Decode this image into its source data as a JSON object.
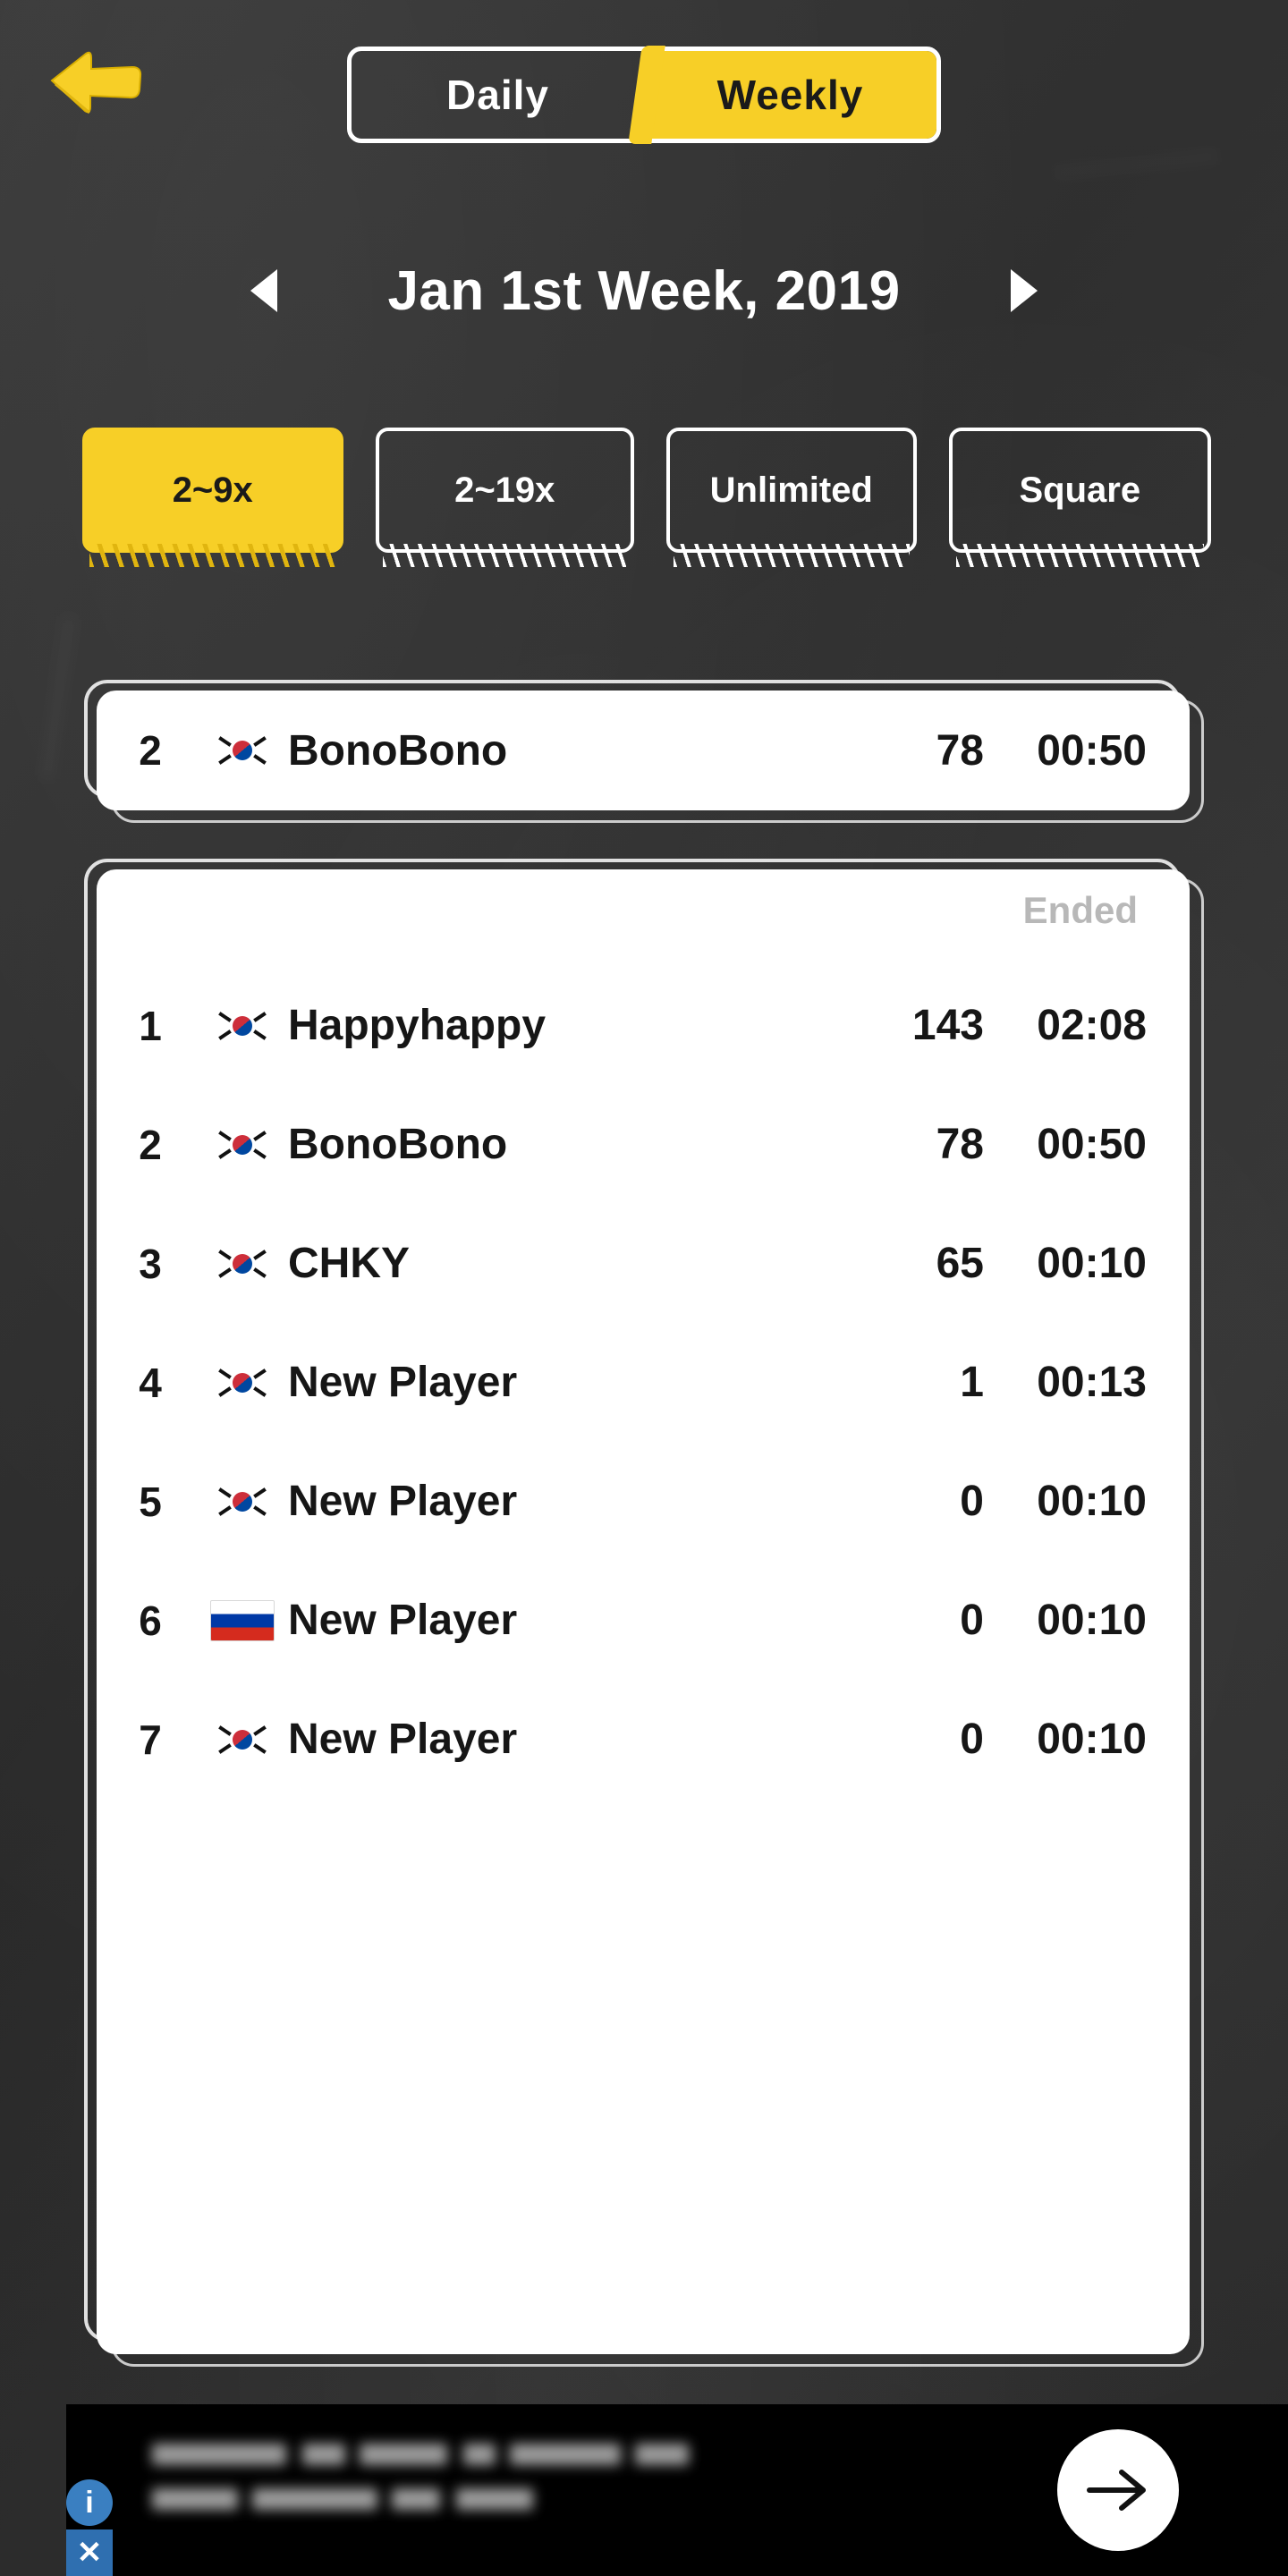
{
  "header": {
    "back_icon": "back-arrow-icon",
    "modes": [
      {
        "label": "Daily",
        "active": false
      },
      {
        "label": "Weekly",
        "active": true
      }
    ]
  },
  "period": {
    "prev_icon": "triangle-left-icon",
    "next_icon": "triangle-right-icon",
    "title": "Jan 1st Week, 2019"
  },
  "filters": [
    {
      "label": "2~9x",
      "active": true
    },
    {
      "label": "2~19x",
      "active": false
    },
    {
      "label": "Unlimited",
      "active": false
    },
    {
      "label": "Square",
      "active": false
    }
  ],
  "my_rank": {
    "rank": "2",
    "flag": "kr",
    "name": "BonoBono",
    "score": "78",
    "time": "00:50"
  },
  "leaderboard": {
    "status": "Ended",
    "columns": [
      "rank",
      "flag",
      "name",
      "score",
      "time"
    ],
    "rows": [
      {
        "rank": "1",
        "flag": "kr",
        "name": "Happyhappy",
        "score": "143",
        "time": "02:08"
      },
      {
        "rank": "2",
        "flag": "kr",
        "name": "BonoBono",
        "score": "78",
        "time": "00:50"
      },
      {
        "rank": "3",
        "flag": "kr",
        "name": "CHKY",
        "score": "65",
        "time": "00:10"
      },
      {
        "rank": "4",
        "flag": "kr",
        "name": "New Player",
        "score": "1",
        "time": "00:13"
      },
      {
        "rank": "5",
        "flag": "kr",
        "name": "New Player",
        "score": "0",
        "time": "00:10"
      },
      {
        "rank": "6",
        "flag": "ru",
        "name": "New Player",
        "score": "0",
        "time": "00:10"
      },
      {
        "rank": "7",
        "flag": "kr",
        "name": "New Player",
        "score": "0",
        "time": "00:10"
      }
    ]
  },
  "ad": {
    "arrow_icon": "arrow-right-icon",
    "info_badge": "i",
    "close_badge": "✕"
  },
  "colors": {
    "accent": "#f7cf27",
    "background": "#2f2f2f",
    "card": "#ffffff",
    "text_dark": "#161616",
    "text_muted": "#b8b8b8"
  }
}
